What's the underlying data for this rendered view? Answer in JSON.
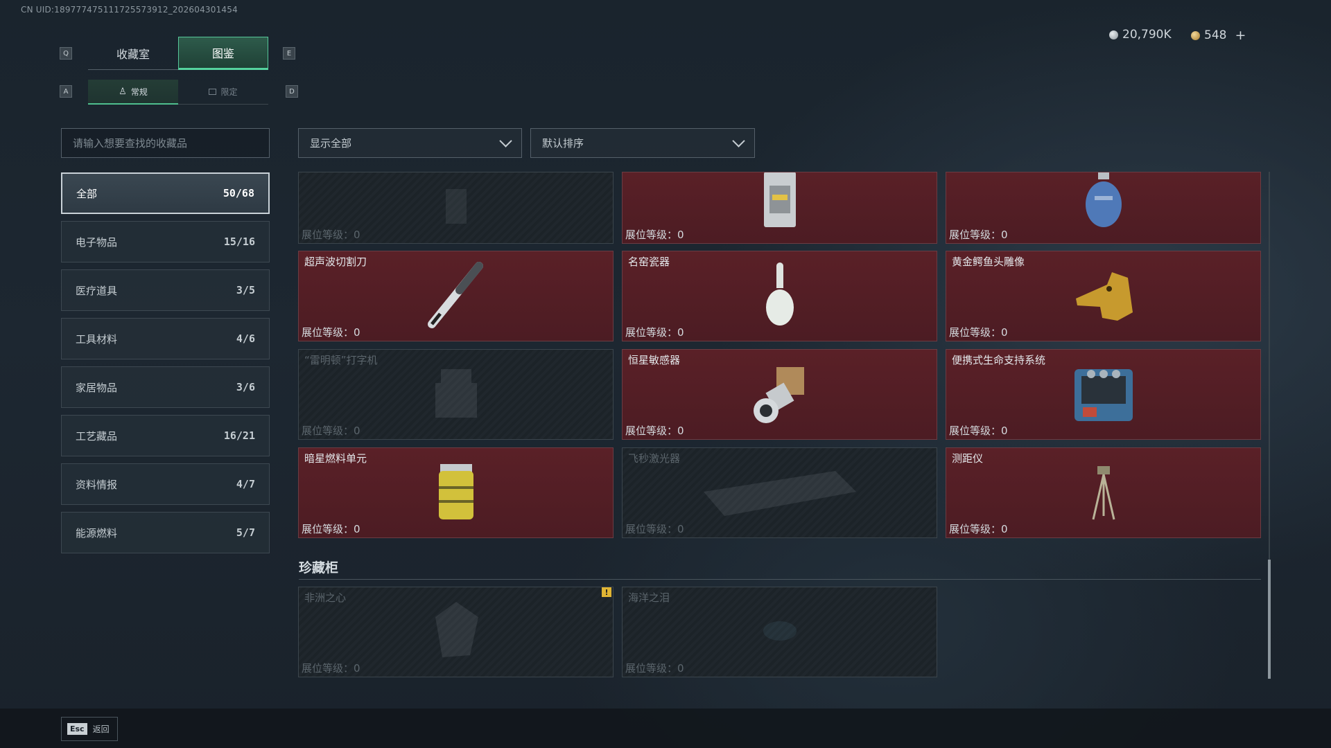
{
  "uid": "CN UID:189777475111725573912_202604301454",
  "tabs": {
    "key_left": "Q",
    "key_right": "E",
    "items": [
      {
        "label": "收藏室"
      },
      {
        "label": "图鉴"
      }
    ]
  },
  "subtabs": {
    "key_left": "A",
    "key_right": "D",
    "items": [
      {
        "label": "常规"
      },
      {
        "label": "限定"
      }
    ]
  },
  "currency": {
    "coins": "20,790K",
    "tokens": "548",
    "add": "+"
  },
  "search": {
    "placeholder": "请输入想要查找的收藏品"
  },
  "categories": [
    {
      "label": "全部",
      "count": "50/68"
    },
    {
      "label": "电子物品",
      "count": "15/16"
    },
    {
      "label": "医疗道具",
      "count": "3/5"
    },
    {
      "label": "工具材料",
      "count": "4/6"
    },
    {
      "label": "家居物品",
      "count": "3/6"
    },
    {
      "label": "工艺藏品",
      "count": "16/21"
    },
    {
      "label": "资料情报",
      "count": "4/7"
    },
    {
      "label": "能源燃料",
      "count": "5/7"
    }
  ],
  "filter": {
    "show": "显示全部",
    "sort": "默认排序"
  },
  "level_label": "展位等级：",
  "items": [
    {
      "name": "",
      "level": "0"
    },
    {
      "name": "",
      "level": "0"
    },
    {
      "name": "",
      "level": "0"
    },
    {
      "name": "超声波切割刀",
      "level": "0"
    },
    {
      "name": "名窑瓷器",
      "level": "0"
    },
    {
      "name": "黄金鳄鱼头雕像",
      "level": "0"
    },
    {
      "name": "“雷明顿”打字机",
      "level": "0"
    },
    {
      "name": "恒星敏感器",
      "level": "0"
    },
    {
      "name": "便携式生命支持系统",
      "level": "0"
    },
    {
      "name": "暗星燃料单元",
      "level": "0"
    },
    {
      "name": "飞秒激光器",
      "level": "0"
    },
    {
      "name": "测距仪",
      "level": "0"
    }
  ],
  "cabinet": {
    "title": "珍藏柜",
    "items": [
      {
        "name": "非洲之心",
        "level": "0"
      },
      {
        "name": "海洋之泪",
        "level": "0"
      }
    ],
    "warn": "!"
  },
  "footer": {
    "esc_key": "Esc",
    "back": "返回"
  }
}
